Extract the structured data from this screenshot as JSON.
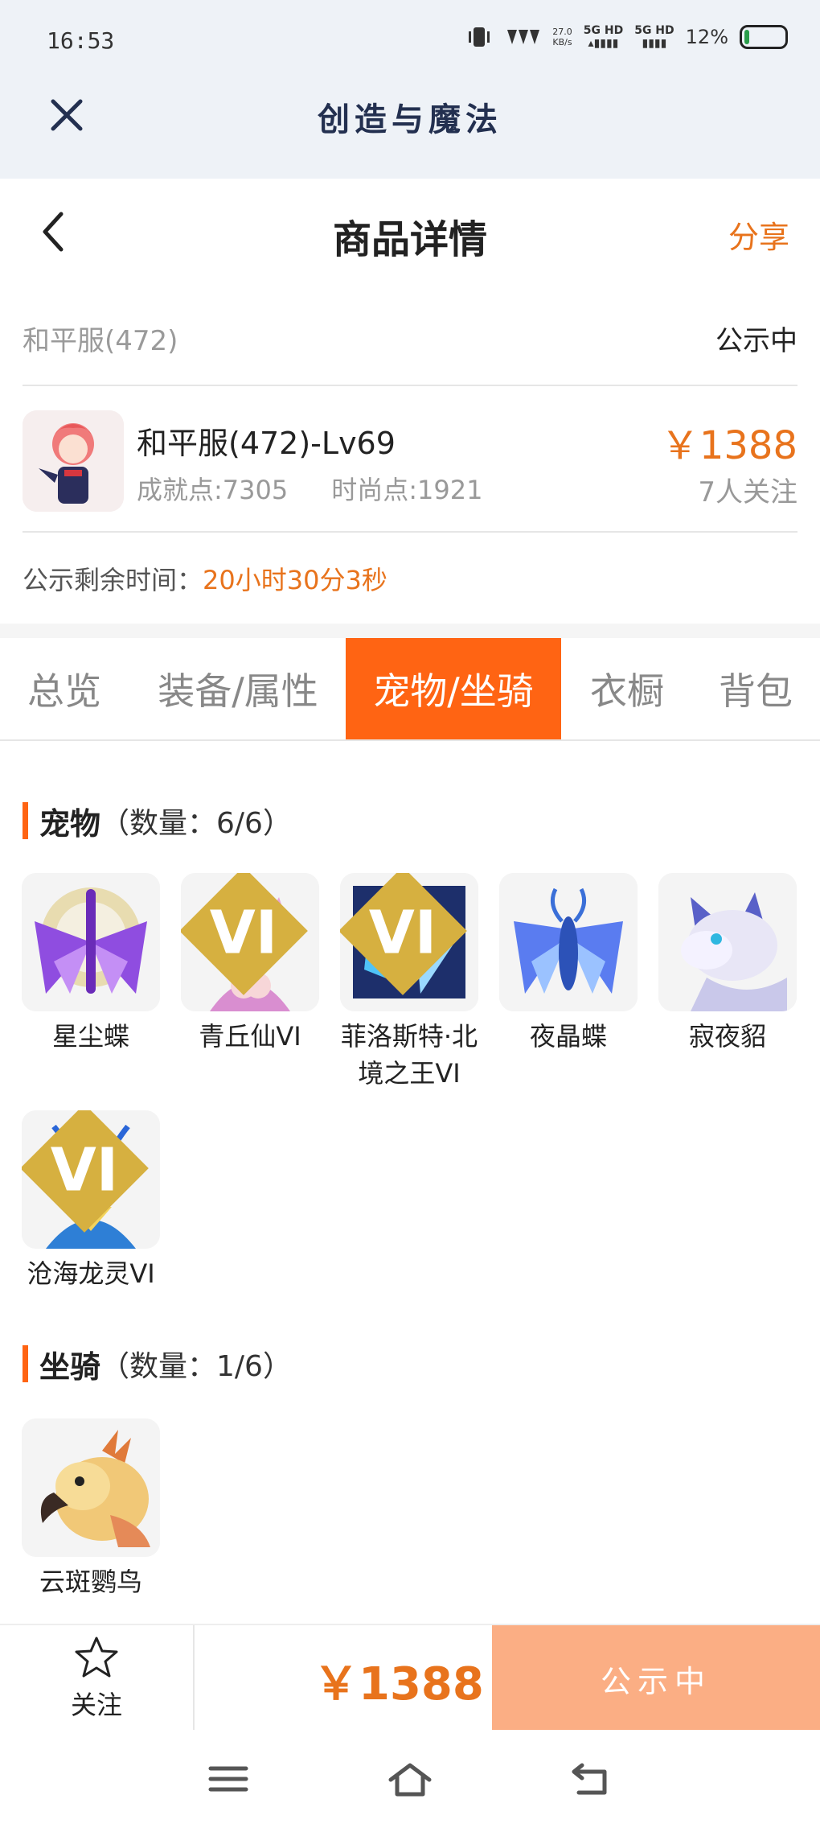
{
  "status_bar": {
    "time": "16:53",
    "net_speed": "27.0",
    "net_unit": "KB/s",
    "signal1": "5G HD",
    "signal2": "5G HD",
    "battery": "12%"
  },
  "app": {
    "title": "创造与魔法"
  },
  "nav": {
    "title": "商品详情",
    "share": "分享"
  },
  "server": {
    "name": "和平服(472)",
    "status": "公示中"
  },
  "character": {
    "name": "和平服(472)-Lv69",
    "achievement": "成就点:7305",
    "fashion": "时尚点:1921",
    "price": "￥1388",
    "followers": "7人关注"
  },
  "countdown": {
    "label": "公示剩余时间：",
    "value": "20小时30分3秒"
  },
  "tabs": [
    {
      "label": "总览"
    },
    {
      "label": "装备/属性"
    },
    {
      "label": "宠物/坐骑"
    },
    {
      "label": "衣橱"
    },
    {
      "label": "背包"
    }
  ],
  "pets": {
    "title": "宠物",
    "count": "（数量：6/6）",
    "items": [
      {
        "name": "星尘蝶"
      },
      {
        "name": "青丘仙VI"
      },
      {
        "name": "菲洛斯特·北境之王VI"
      },
      {
        "name": "夜晶蝶"
      },
      {
        "name": "寂夜貂"
      },
      {
        "name": "沧海龙灵VI"
      }
    ]
  },
  "mounts": {
    "title": "坐骑",
    "count": "（数量：1/6）",
    "items": [
      {
        "name": "云斑鹦鸟"
      }
    ]
  },
  "bottom": {
    "follow": "关注",
    "price": "￥1388",
    "status": "公示中"
  },
  "badge_text": "VI",
  "colors": {
    "accent": "#ff6413",
    "price": "#e8731c",
    "disabled_button": "#fbae84"
  }
}
